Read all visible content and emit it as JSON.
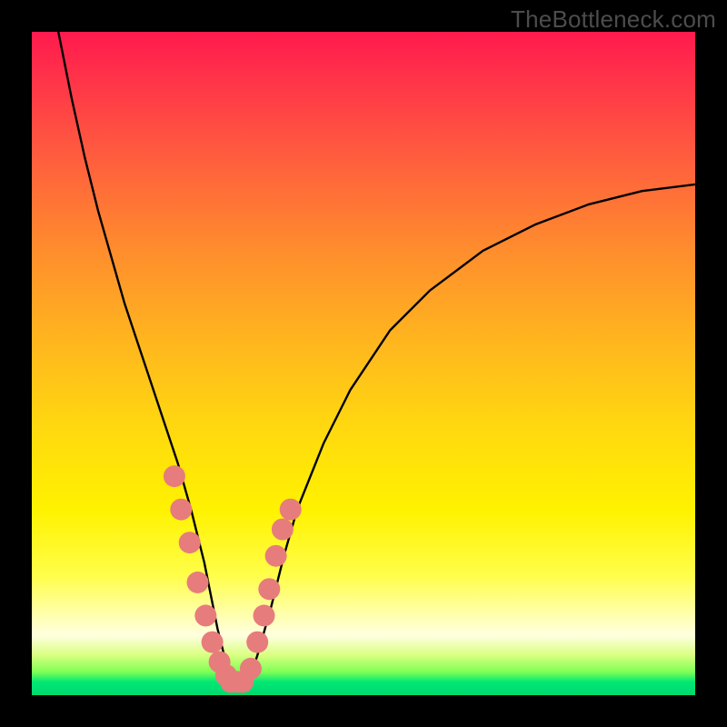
{
  "watermark": "TheBottleneck.com",
  "chart_data": {
    "type": "line",
    "title": "",
    "xlabel": "",
    "ylabel": "",
    "xlim": [
      0,
      100
    ],
    "ylim": [
      0,
      100
    ],
    "grid": false,
    "curve": {
      "x": [
        4,
        6,
        8,
        10,
        12,
        14,
        16,
        18,
        20,
        22,
        24,
        25,
        26,
        27,
        28,
        29,
        30,
        31,
        32,
        33,
        34,
        36,
        38,
        40,
        44,
        48,
        54,
        60,
        68,
        76,
        84,
        92,
        100
      ],
      "y_pct": [
        100,
        90,
        81,
        73,
        66,
        59,
        53,
        47,
        41,
        35,
        28,
        24,
        20,
        15,
        10,
        6,
        3,
        2,
        2,
        3,
        6,
        13,
        21,
        28,
        38,
        46,
        55,
        61,
        67,
        71,
        74,
        76,
        77
      ]
    },
    "markers": {
      "x": [
        21.5,
        22.5,
        23.8,
        25.0,
        26.2,
        27.2,
        28.3,
        29.3,
        30.0,
        31.0,
        31.8,
        33.0,
        34.0,
        35.0,
        35.8,
        36.8,
        37.8,
        39.0
      ],
      "y_pct": [
        33,
        28,
        23,
        17,
        12,
        8,
        5,
        3,
        2,
        2,
        2,
        4,
        8,
        12,
        16,
        21,
        25,
        28
      ],
      "color": "#e77c7c",
      "radius_px": 12
    }
  }
}
